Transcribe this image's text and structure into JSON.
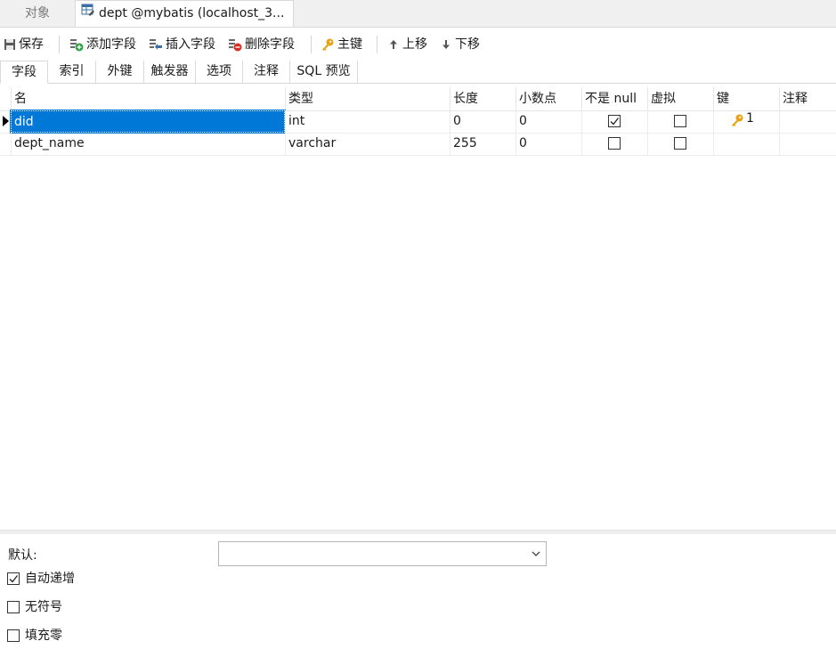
{
  "tabs": {
    "objects_label": "对象",
    "active_label": "dept @mybatis (localhost_3..."
  },
  "toolbar": {
    "save": "保存",
    "add_field": "添加字段",
    "insert_field": "插入字段",
    "delete_field": "删除字段",
    "primary_key": "主键",
    "move_up": "上移",
    "move_down": "下移"
  },
  "subtabs": [
    "字段",
    "索引",
    "外键",
    "触发器",
    "选项",
    "注释",
    "SQL 预览"
  ],
  "grid": {
    "headers": [
      "名",
      "类型",
      "长度",
      "小数点",
      "不是 null",
      "虚拟",
      "键",
      "注释"
    ],
    "rows": [
      {
        "name": "did",
        "type": "int",
        "length": "0",
        "decimals": "0",
        "not_null": true,
        "virtual": false,
        "key": "1",
        "comment": ""
      },
      {
        "name": "dept_name",
        "type": "varchar",
        "length": "255",
        "decimals": "0",
        "not_null": false,
        "virtual": false,
        "key": "",
        "comment": ""
      }
    ]
  },
  "options": {
    "default_label": "默认:",
    "default_value": "",
    "auto_increment_label": "自动递增",
    "auto_increment": true,
    "unsigned_label": "无符号",
    "unsigned": false,
    "zerofill_label": "填充零",
    "zerofill": false
  },
  "icons": {
    "table_tab": "table-design-icon",
    "save": "save-icon",
    "add": "add-field-icon",
    "insert": "insert-field-icon",
    "delete": "delete-field-icon",
    "key": "key-icon",
    "up": "arrow-up-icon",
    "down": "arrow-down-icon"
  },
  "colors": {
    "selection": "#0078d7",
    "key_gold": "#e8a317",
    "add_green": "#2ea043",
    "delete_red": "#d93025"
  }
}
